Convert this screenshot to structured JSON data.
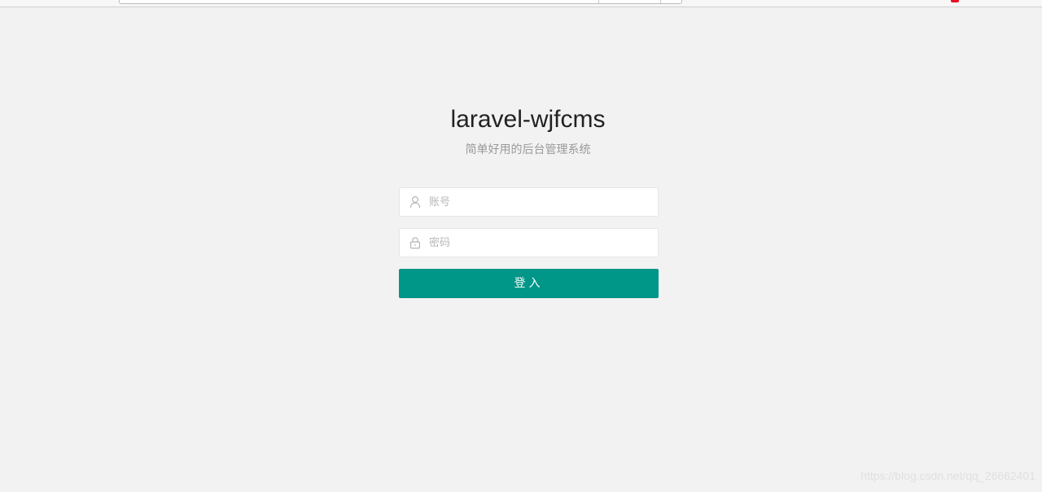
{
  "header": {
    "title": "laravel-wjfcms",
    "subtitle": "简单好用的后台管理系统"
  },
  "form": {
    "username": {
      "placeholder": "账号",
      "value": "",
      "icon": "user-icon"
    },
    "password": {
      "placeholder": "密码",
      "value": "",
      "icon": "lock-icon"
    },
    "submit_label": "登入"
  },
  "watermark": "https://blog.csdn.net/qq_26662401",
  "colors": {
    "page_background": "#f2f2f2",
    "button_background": "#009688",
    "button_text": "#ffffff",
    "subtitle_text": "#999999",
    "placeholder_text": "#b8b8b8"
  }
}
